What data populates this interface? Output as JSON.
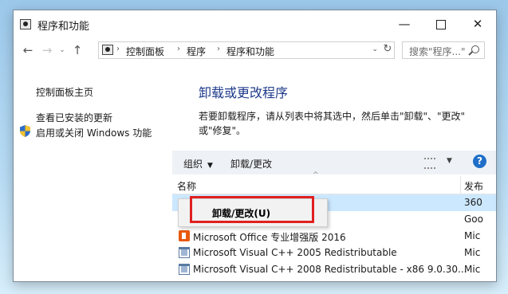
{
  "window": {
    "title": "程序和功能"
  },
  "titlebar": {
    "minimize": "—",
    "close": "✕"
  },
  "nav": {
    "back": "←",
    "forward": "→",
    "history": "⌄",
    "up": "↑",
    "refresh": "↻"
  },
  "breadcrumb": {
    "items": [
      "控制面板",
      "程序",
      "程序和功能"
    ],
    "separator": "›"
  },
  "search": {
    "placeholder": "搜索\"程序...\""
  },
  "sidebar": {
    "items": [
      {
        "label": "控制面板主页"
      },
      {
        "label": "查看已安装的更新"
      },
      {
        "label": "启用或关闭 Windows 功能"
      }
    ]
  },
  "main": {
    "heading": "卸载或更改程序",
    "desc_line1": "若要卸载程序，请从列表中将其选中，然后单击\"卸载\"、\"更改\"",
    "desc_line2": "或\"修复\"。"
  },
  "toolbar": {
    "organize": "组织",
    "uninstall_change": "卸载/更改",
    "help": "?"
  },
  "columns": {
    "name": "名称",
    "publisher": "发布"
  },
  "rows": [
    {
      "name": "",
      "publisher": "360",
      "icon": "app-icon",
      "selected": true
    },
    {
      "name": "",
      "publisher": "Goo",
      "icon": "app-icon",
      "selected": false
    },
    {
      "name": "Microsoft Office 专业增强版 2016",
      "publisher": "Mic",
      "icon": "office-icon"
    },
    {
      "name": "Microsoft Visual C++ 2005 Redistributable",
      "publisher": "Mic",
      "icon": "vs-installer-icon"
    },
    {
      "name": "Microsoft Visual C++ 2008 Redistributable - x86 9.0.30...",
      "publisher": "Mic",
      "icon": "vs-installer-icon"
    }
  ],
  "context_menu": {
    "item": "卸载/更改(U)"
  },
  "colors": {
    "accent": "#1e3a8a",
    "selection": "#cce8ff",
    "highlight_box": "#e02020",
    "toolbar_bg": "#eef2f6"
  }
}
